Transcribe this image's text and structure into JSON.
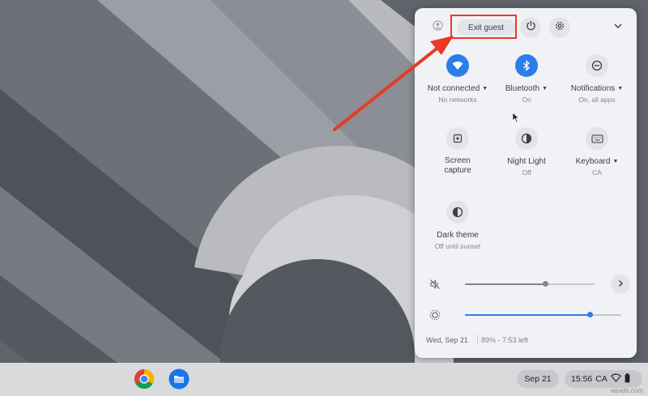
{
  "panel": {
    "exit_guest_label": "Exit guest",
    "tiles": [
      {
        "label": "Not connected",
        "sub": "No networks",
        "has_menu": true,
        "icon": "wifi-icon",
        "active": true
      },
      {
        "label": "Bluetooth",
        "sub": "On",
        "has_menu": true,
        "icon": "bluetooth-icon",
        "active": true
      },
      {
        "label": "Notifications",
        "sub": "On, all apps",
        "has_menu": true,
        "icon": "notifications-icon",
        "active": false
      },
      {
        "label_line1": "Screen",
        "label_line2": "capture",
        "icon": "screen-capture-icon",
        "active": false
      },
      {
        "label": "Night Light",
        "sub": "Off",
        "icon": "night-light-icon",
        "active": false
      },
      {
        "label": "Keyboard",
        "sub": "CA",
        "has_menu": true,
        "icon": "keyboard-icon",
        "active": false
      },
      {
        "label": "Dark theme",
        "sub": "Off until sunset",
        "icon": "dark-theme-icon",
        "active": false
      }
    ],
    "volume": {
      "level": 0.62,
      "muted": true
    },
    "brightness": {
      "level": 0.8
    },
    "footer": {
      "date": "Wed, Sep 21",
      "battery": "89% - 7:53 left"
    }
  },
  "shelf": {
    "date": "Sep 21",
    "time": "15:56",
    "ime": "CA"
  },
  "colors": {
    "accent": "#2b7de9",
    "annotation": "#e8392a",
    "panel_bg": "#f1f2f5",
    "shelf_bg": "#d9dadc"
  },
  "watermark": "wsxdn.com"
}
